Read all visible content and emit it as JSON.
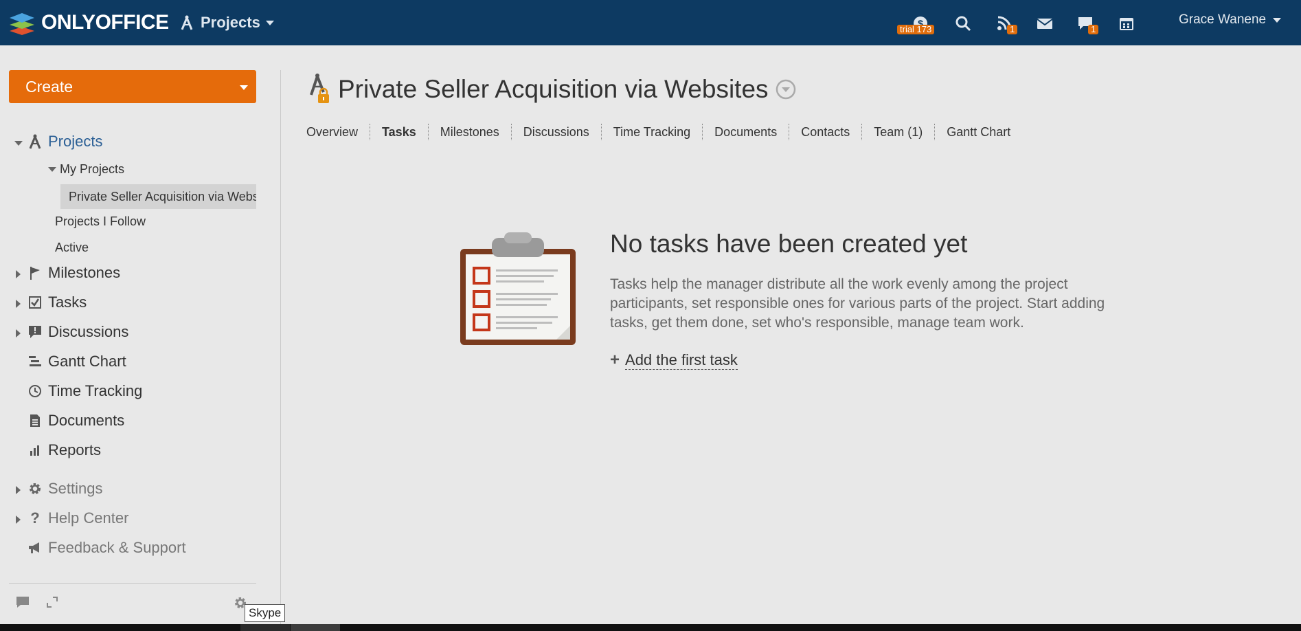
{
  "header": {
    "logo_text": "ONLYOFFICE",
    "module_label": "Projects",
    "trial_badge": "trial 173",
    "feed_badge": "1",
    "chat_badge": "1",
    "user_name": "Grace Wanene",
    "icons": [
      "payment-icon",
      "search-icon",
      "feed-icon",
      "mail-icon",
      "chat-icon",
      "calendar-icon"
    ]
  },
  "sidebar": {
    "create_label": "Create",
    "projects_label": "Projects",
    "my_projects_label": "My Projects",
    "selected_project": "Private Seller Acquisition via Websites",
    "follow_label": "Projects I Follow",
    "active_label": "Active",
    "milestones_label": "Milestones",
    "tasks_label": "Tasks",
    "discussions_label": "Discussions",
    "gantt_label": "Gantt Chart",
    "time_label": "Time Tracking",
    "documents_label": "Documents",
    "reports_label": "Reports",
    "settings_label": "Settings",
    "help_label": "Help Center",
    "feedback_label": "Feedback & Support",
    "tooltip": "Skype"
  },
  "main": {
    "project_title": "Private Seller Acquisition via Websites",
    "tabs": [
      "Overview",
      "Tasks",
      "Milestones",
      "Discussions",
      "Time Tracking",
      "Documents",
      "Contacts",
      "Team (1)",
      "Gantt Chart"
    ],
    "active_tab": "Tasks",
    "empty_title": "No tasks have been created yet",
    "empty_desc": "Tasks help the manager distribute all the work evenly among the project participants, set responsible ones for various parts of the project. Start adding tasks, get them done, set who's responsible, manage team work.",
    "add_label": "Add the first task"
  },
  "colors": {
    "topbar": "#0d3a62",
    "accent": "#e56b0b",
    "link": "#2b5f95"
  }
}
